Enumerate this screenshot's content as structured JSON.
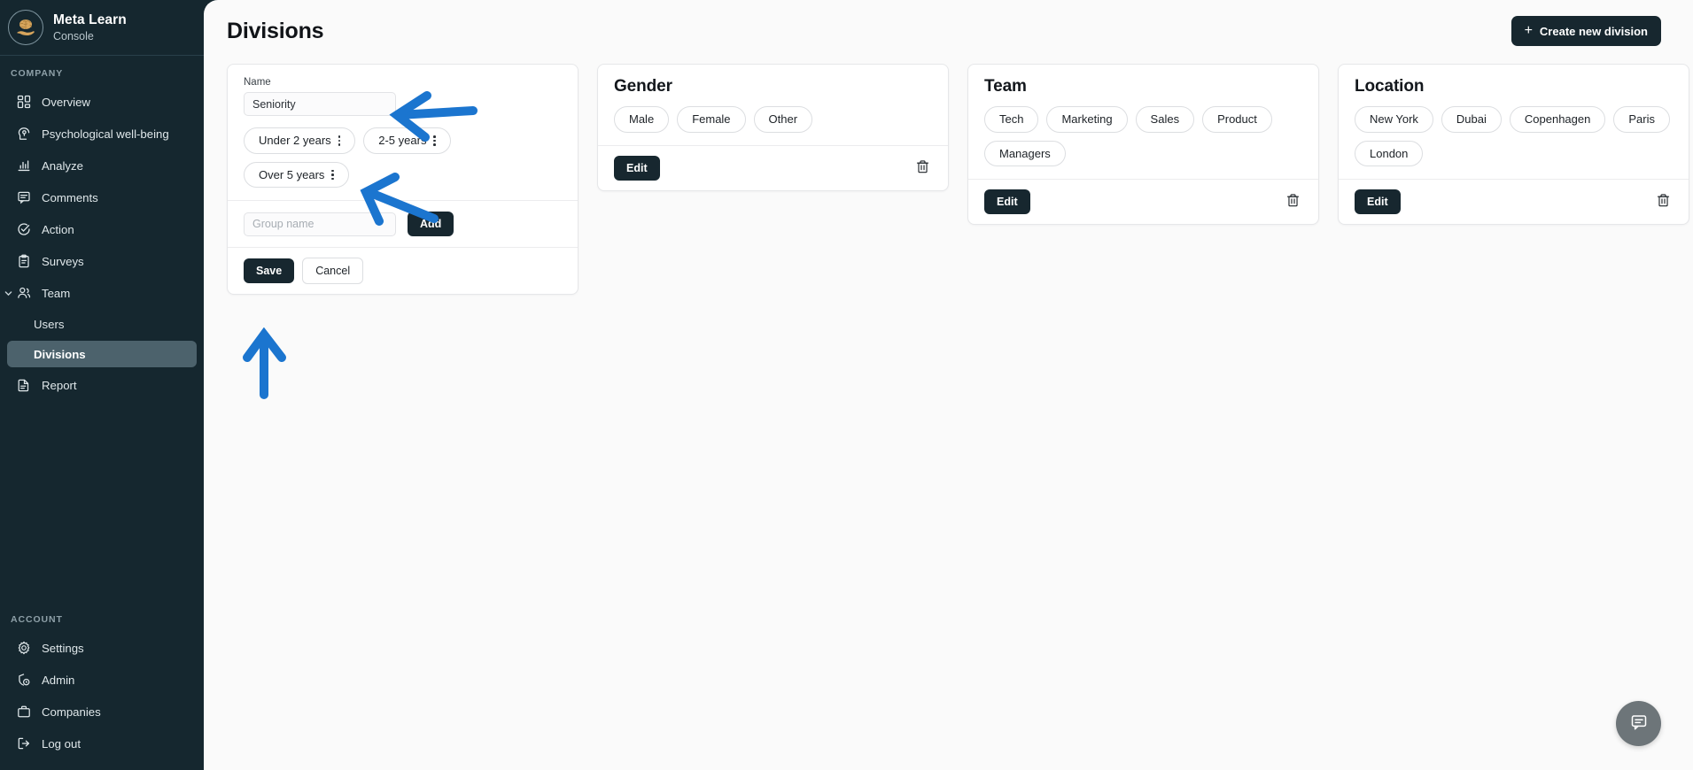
{
  "sidebar": {
    "brand": {
      "title": "Meta Learn",
      "subtitle": "Console",
      "logo_icon": "brain-in-hand-logo"
    },
    "company_label": "COMPANY",
    "company_items": [
      {
        "label": "Overview",
        "icon": "dashboard-grid-icon"
      },
      {
        "label": "Psychological well-being",
        "icon": "head-mind-icon"
      },
      {
        "label": "Analyze",
        "icon": "bar-chart-icon"
      },
      {
        "label": "Comments",
        "icon": "comment-icon"
      },
      {
        "label": "Action",
        "icon": "check-circle-icon"
      },
      {
        "label": "Surveys",
        "icon": "clipboard-icon"
      },
      {
        "label": "Team",
        "icon": "users-icon"
      }
    ],
    "team_children": [
      {
        "label": "Users",
        "active": false
      },
      {
        "label": "Divisions",
        "active": true
      }
    ],
    "report_item": {
      "label": "Report",
      "icon": "document-icon"
    },
    "account_label": "ACCOUNT",
    "account_items": [
      {
        "label": "Settings",
        "icon": "gear-icon"
      },
      {
        "label": "Admin",
        "icon": "shield-user-icon"
      },
      {
        "label": "Companies",
        "icon": "briefcase-icon"
      },
      {
        "label": "Log out",
        "icon": "logout-icon"
      }
    ]
  },
  "header": {
    "title": "Divisions",
    "create_button": "Create new division",
    "create_button_icon": "plus-icon"
  },
  "edit_card": {
    "name_label": "Name",
    "name_value": "Seniority",
    "name_placeholder": "Name",
    "groups": [
      "Under 2 years",
      "2-5 years",
      "Over 5 years"
    ],
    "group_menu_icon": "kebab-menu-icon",
    "add_placeholder": "Group name",
    "add_value": "",
    "add_button": "Add",
    "save_button": "Save",
    "cancel_button": "Cancel"
  },
  "cards": [
    {
      "title": "Gender",
      "groups": [
        "Male",
        "Female",
        "Other"
      ],
      "edit_button": "Edit",
      "delete_icon": "trash-icon"
    },
    {
      "title": "Team",
      "groups": [
        "Tech",
        "Marketing",
        "Sales",
        "Product",
        "Managers"
      ],
      "edit_button": "Edit",
      "delete_icon": "trash-icon"
    },
    {
      "title": "Location",
      "groups": [
        "New York",
        "Dubai",
        "Copenhagen",
        "Paris",
        "London"
      ],
      "edit_button": "Edit",
      "delete_icon": "trash-icon"
    }
  ],
  "annotations": [
    {
      "name": "arrow-pointing-to-name-input",
      "direction": "left",
      "color": "#1b75cf"
    },
    {
      "name": "arrow-pointing-to-group-chip",
      "direction": "left",
      "color": "#1b75cf"
    },
    {
      "name": "arrow-pointing-to-save-button",
      "direction": "up",
      "color": "#1b75cf"
    }
  ],
  "chat_fab": {
    "icon": "chat-bubble-icon",
    "color": "#6d7579"
  },
  "colors": {
    "sidebar_bg": "#15272f",
    "page_bg": "#fafafa",
    "accent_dark": "#17272f",
    "annotation_blue": "#1b75cf",
    "active_nav_bg": "#4c626c"
  }
}
